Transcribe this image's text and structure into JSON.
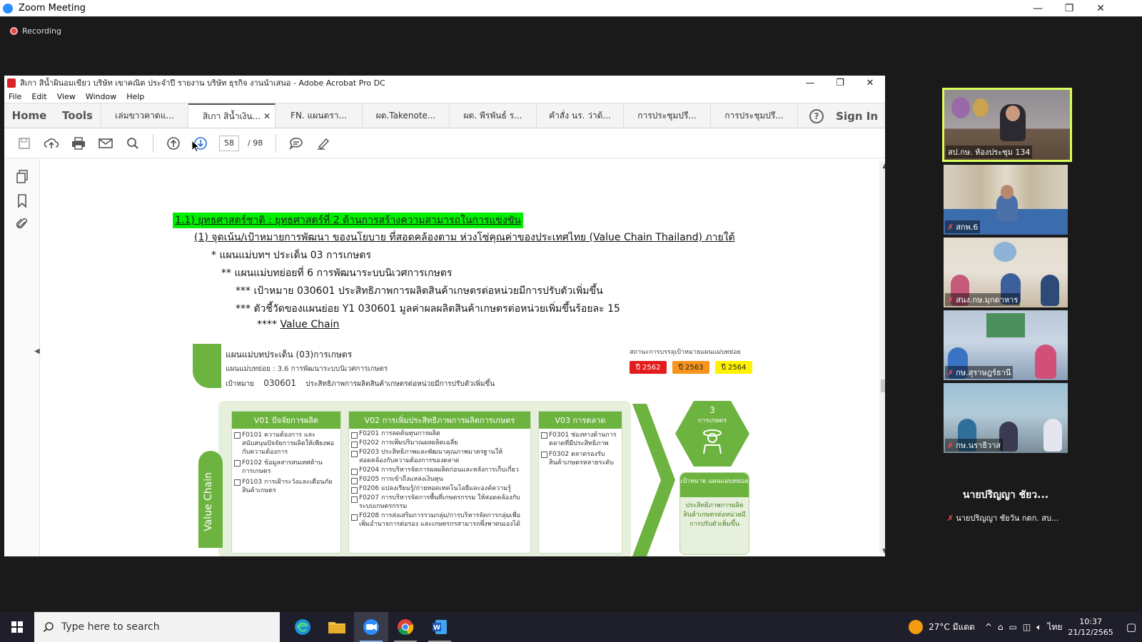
{
  "zoom": {
    "title": "Zoom Meeting",
    "recording_label": "Recording"
  },
  "acrobat": {
    "title": "สิเกา สิน้ำผินอมเขียว บริษัท เขาคณิต ประจำปี รายงาน บริษัท ธุรกิจ งานนำเสนอ - Adobe Acrobat Pro DC",
    "menu": [
      "File",
      "Edit",
      "View",
      "Window",
      "Help"
    ],
    "home_label": "Home",
    "tools_label": "Tools",
    "tabs": [
      {
        "label": "เล่มขาวคาดแ..."
      },
      {
        "label": "สิเกา สิน้ำเงิน..."
      },
      {
        "label": "FN. แผนตรา..."
      },
      {
        "label": "ผต.Takenote..."
      },
      {
        "label": "ผต. พีรพันธ์ ร..."
      },
      {
        "label": "คำสั่ง นร. ว่าด้..."
      },
      {
        "label": "การประชุมปรึ..."
      },
      {
        "label": "การประชุมปรึ..."
      }
    ],
    "signin_label": "Sign In",
    "page_current": "58",
    "page_total": "/ 98"
  },
  "document": {
    "heading": "1.1) ยุทธศาสตร์ชาติ : ยุทธศาสตร์ที่ 2 ด้านการสร้างความสามารถในการแข่งขัน",
    "line1": "(1) จุดเน้น/เป้าหมายการพัฒนา ของนโยบาย ที่สอดคล้องตาม ห่วงโซ่คุณค่าของประเทศไทย (Value Chain Thailand) ภายใต้",
    "line2": "* แผนแม่บทฯ ประเด็น 03 การเกษตร",
    "line3": "** แผนแม่บทย่อยที่ 6 การพัฒนาระบบนิเวศการเกษตร",
    "line4": "*** เป้าหมาย 030601 ประสิทธิภาพการผลิตสินค้าเกษตรต่อหน่วยมีการปรับตัวเพิ่มขึ้น",
    "line5": "*** ตัวชี้วัดของแผนย่อย Y1 030601 มูลค่าผลผลิตสินค้าเกษตรต่อหน่วยเพิ่มขึ้นร้อยละ 15",
    "line6_prefix": "****",
    "line6_link": "Value Chain",
    "figure": {
      "header1": "แผนแม่บทประเด็น (03)การเกษตร",
      "header2": "แผนแม่บทย่อย : 3.6 การพัฒนาระบบนิเวศการเกษตร",
      "header3_label": "เป้าหมาย",
      "header3_code": "030601",
      "header3_text": "ประสิทธิภาพการผลิตสินค้าเกษตรต่อหน่วยมีการปรับตัวเพิ่มขึ้น",
      "status_label": "สถานะการบรรลุเป้าหมายแผนแม่บทย่อย",
      "years": [
        "ปี 2562",
        "ปี 2563",
        "ปี 2564"
      ],
      "vertical_label": "Value Chain",
      "columns": [
        {
          "head": "V01 ปัจจัยการผลิต",
          "items": [
            "F0101 ความต้องการ และสนับสนุนปัจจัยการผลิตให้เพียงพอกับความต้องการ",
            "F0102 ข้อมูลสารสนเทศด้านการเกษตร",
            "F0103 การเฝ้าระวังและเตือนภัยสินค้าเกษตร"
          ]
        },
        {
          "head": "V02 การเพิ่มประสิทธิภาพการผลิตการเกษตร",
          "items": [
            "F0201 การลดต้นทุนการผลิต",
            "F0202 การเพิ่มปริมาณผลผลิตเฉลี่ย",
            "F0203 ประสิทธิภาพและพัฒนาคุณภาพมาตรฐานให้สอดคล้องกับความต้องการของตลาด",
            "F0204 การบริหารจัดการผลผลิตก่อนและหลังการเก็บเกี่ยว",
            "F0205 การเข้าถึงแหล่งเงินทุน",
            "F0206 แปลงเรียนรู้/ถ่ายทอดเทคโนโลยีและองค์ความรู้",
            "F0207 การบริหารจัดการพื้นที่เกษตรกรรม ให้สอดคล้องกับระบบเกษตรกรรม",
            "F0208 การส่งเสริมการรวมกลุ่ม/การบริหารจัดการกลุ่มเพื่อเพิ่มอำนาจการต่อรอง และเกษตรกรสามารถพึ่งพาตนเองได้"
          ]
        },
        {
          "head": "V03 การตลาด",
          "items": [
            "F0301 ช่องทางด้านการตลาดที่มีประสิทธิภาพ",
            "F0302 ตลาดรองรับสินค้าเกษตรหลายระดับ"
          ]
        }
      ],
      "hex_number": "3",
      "hex_label": "การเกษตร",
      "target_head": "เป้าหมาย แผนแม่บทย่อย",
      "target_body": "ประสิทธิภาพการผลิตสินค้าเกษตรต่อหน่วยมีการปรับตัวเพิ่มขึ้น"
    }
  },
  "participants": [
    {
      "label": "สป.กษ. ห้องประชุม 134",
      "muted": false,
      "active": true
    },
    {
      "label": "สกพ.6",
      "muted": true,
      "active": false
    },
    {
      "label": "สนง.กษ.มุกดาหาร",
      "muted": true,
      "active": false
    },
    {
      "label": "กษ.สุราษฎร์ธานี",
      "muted": true,
      "active": false
    },
    {
      "label": "กษ.นราธิวาส",
      "muted": true,
      "active": false
    },
    {
      "bigname": "นายปริญญา ชัยว...",
      "label": "นายปริญญา ชัยวัน กตก. สบ...",
      "muted": true,
      "active": false
    }
  ],
  "taskbar": {
    "search_placeholder": "Type here to search",
    "weather": "27°C มีแดด",
    "lang": "ไทย",
    "time": "10:37",
    "date": "21/12/2565"
  }
}
